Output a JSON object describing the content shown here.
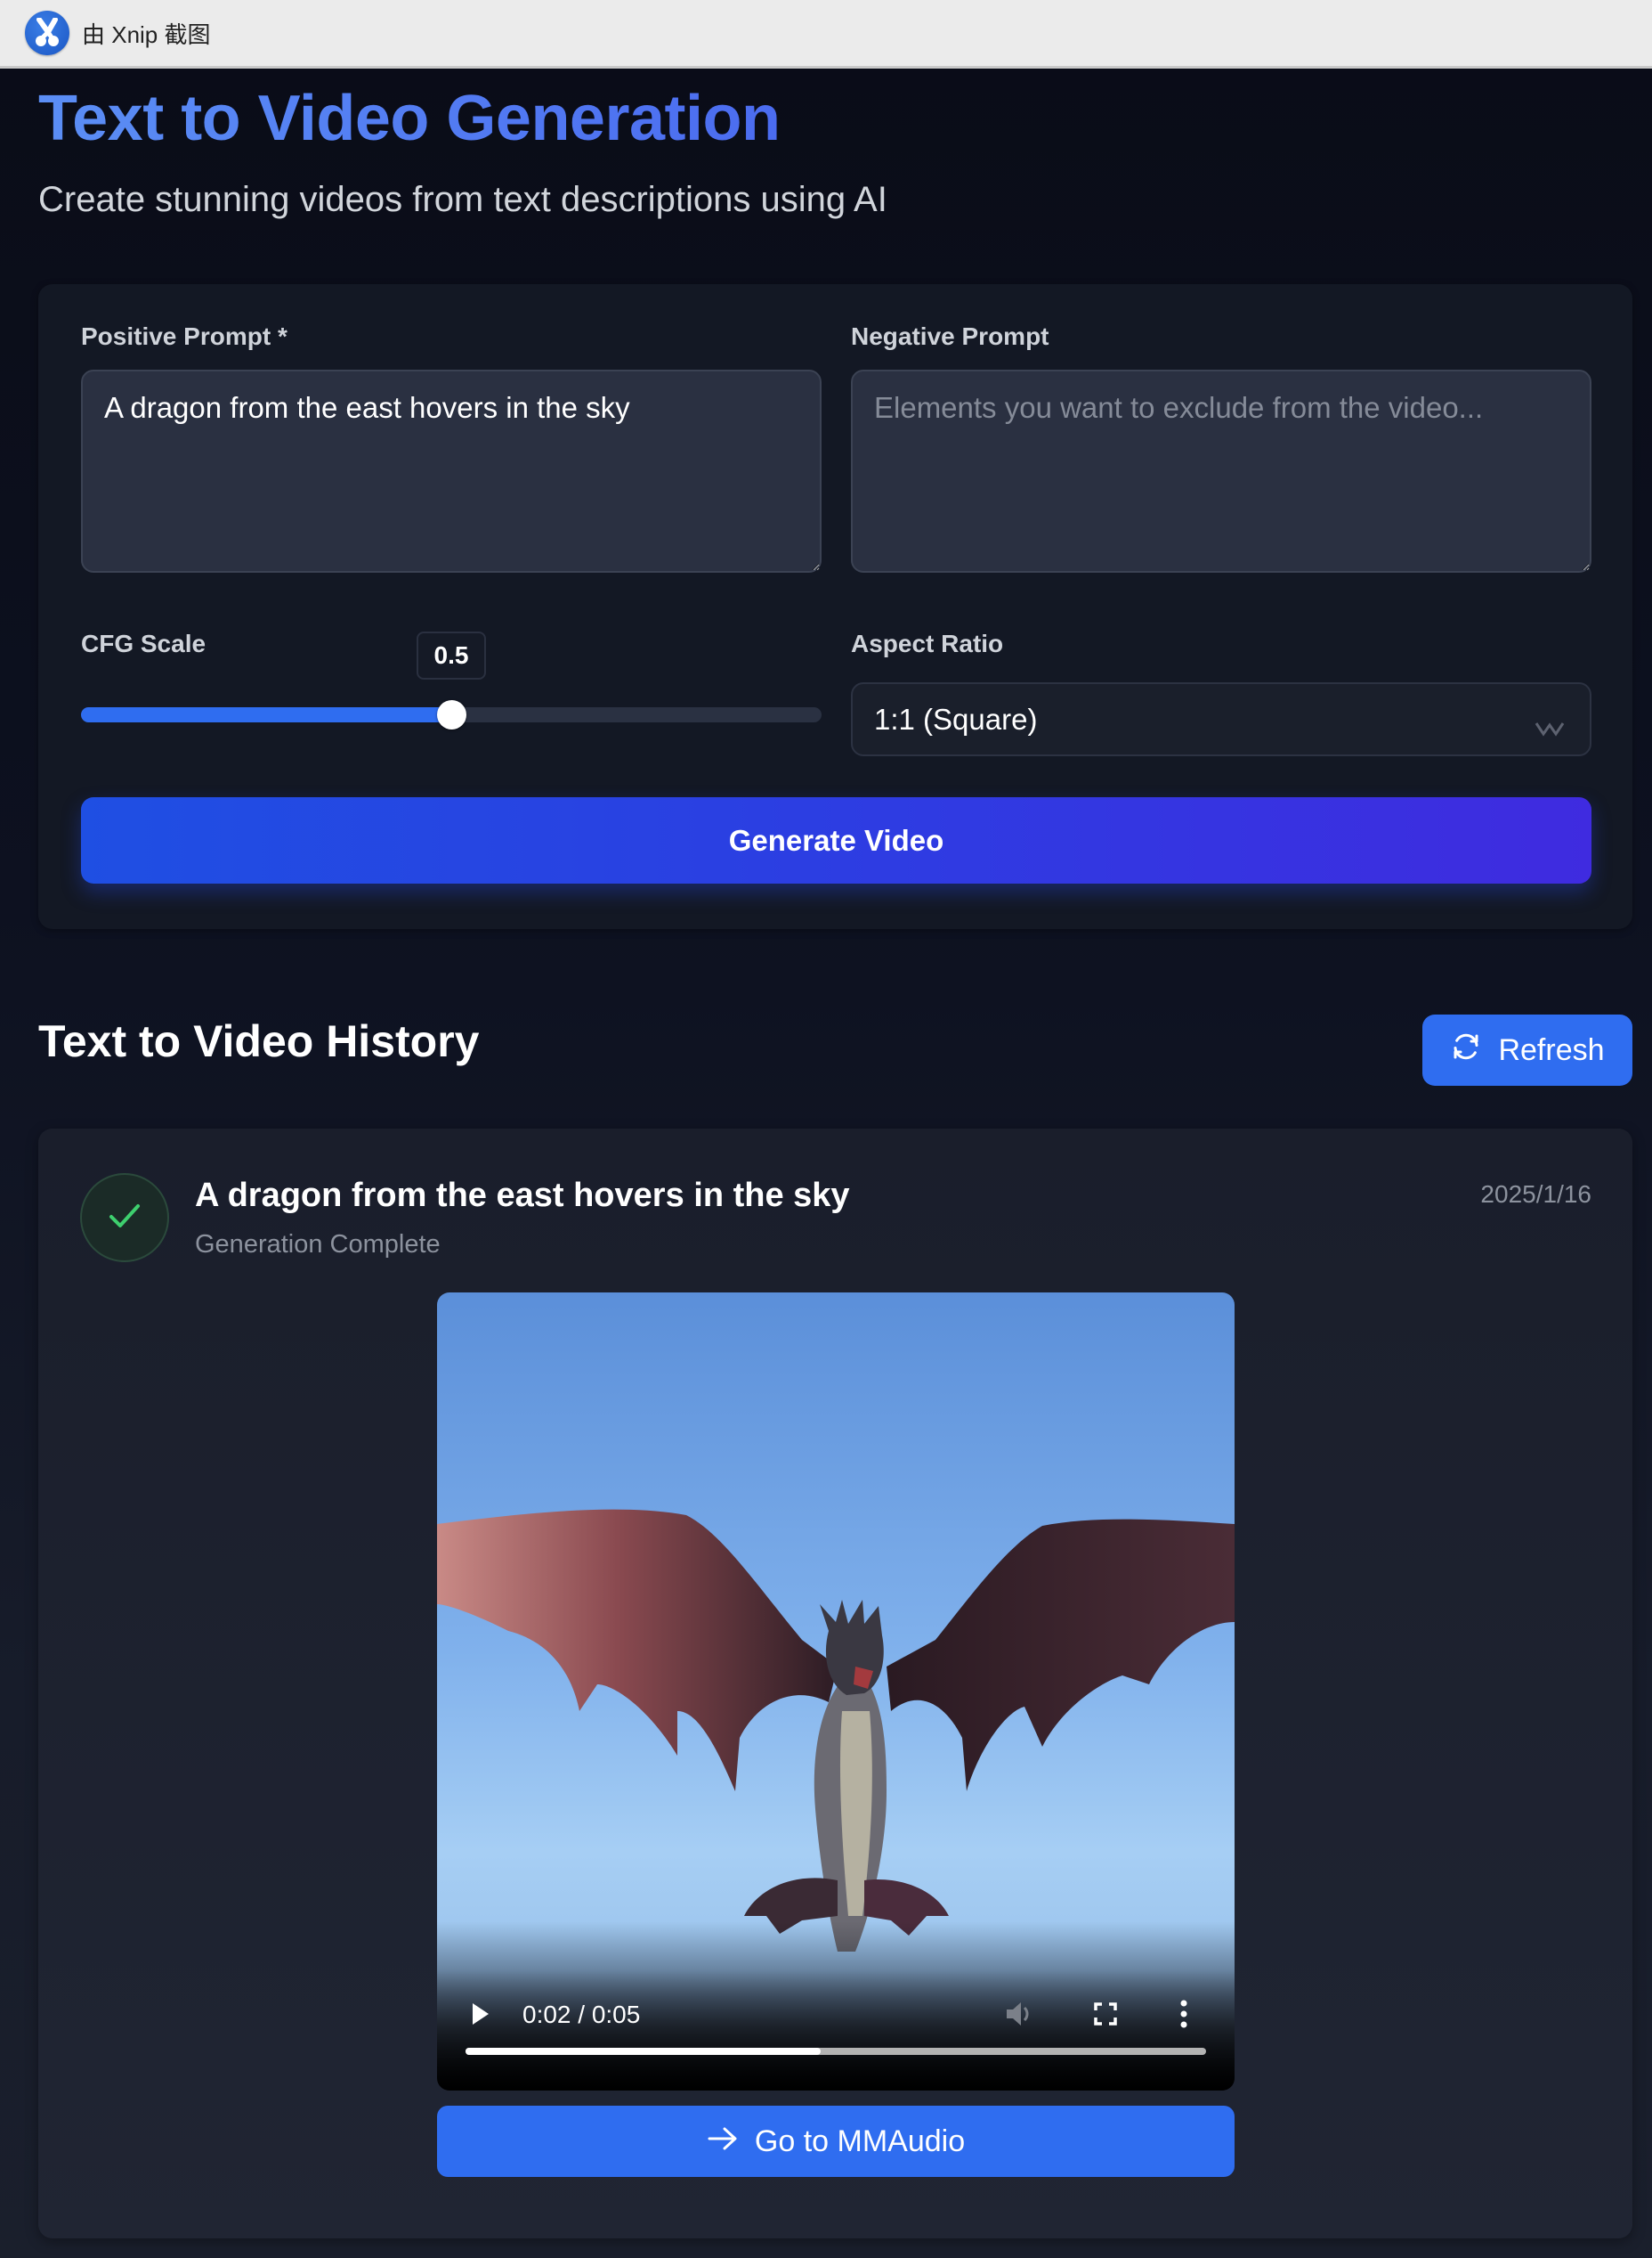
{
  "xnip_bar": {
    "label": "由 Xnip 截图",
    "icon": "scissors-icon"
  },
  "header": {
    "title": "Text to Video Generation",
    "subtitle": "Create stunning videos from text descriptions using AI"
  },
  "form": {
    "positive_prompt": {
      "label": "Positive Prompt *",
      "value": "A dragon from the east hovers in the sky",
      "placeholder": ""
    },
    "negative_prompt": {
      "label": "Negative Prompt",
      "value": "",
      "placeholder": "Elements you want to exclude from the video..."
    },
    "cfg_scale": {
      "label": "CFG Scale",
      "value": "0.5",
      "fraction": 0.5
    },
    "aspect_ratio": {
      "label": "Aspect Ratio",
      "selected": "1:1 (Square)",
      "icon": "chevron-down-icon"
    },
    "generate_button": "Generate Video"
  },
  "history": {
    "title": "Text to Video History",
    "refresh_button": "Refresh",
    "refresh_icon": "refresh-icon",
    "items": [
      {
        "title": "A dragon from the east hovers in the sky",
        "status": "Generation Complete",
        "status_icon": "check-icon",
        "date": "2025/1/16",
        "video": {
          "time": "0:02 / 0:05",
          "progress": 0.48,
          "controls": [
            "play-icon",
            "volume-icon",
            "fullscreen-icon",
            "more-options-icon"
          ]
        },
        "action_button": "Go to MMAudio",
        "action_icon": "arrow-right-icon"
      }
    ]
  },
  "colors": {
    "accent": "#2f6df0",
    "title_gradient_start": "#5b8ef5",
    "title_gradient_end": "#4b6cf0",
    "success": "#3ecf6e",
    "page_bg": "#0a0c17",
    "card_bg": "#131824"
  }
}
